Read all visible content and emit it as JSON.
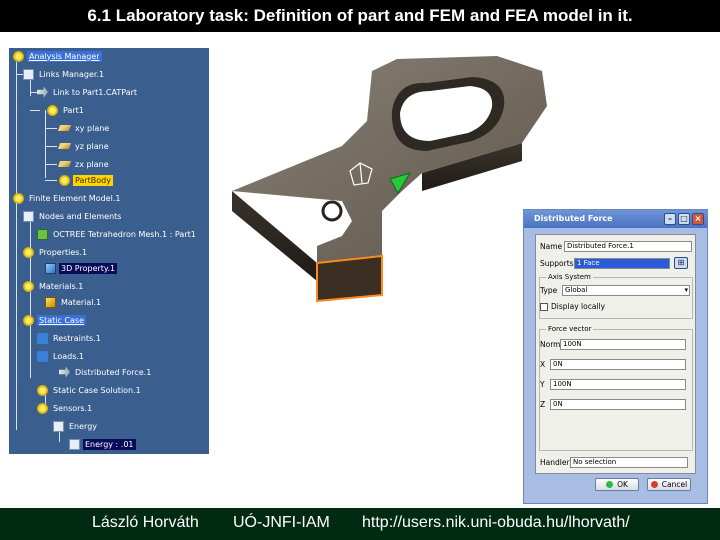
{
  "slide": {
    "title": "6.1 Laboratory task: Definition of part and FEM and FEA model in it."
  },
  "footer": {
    "author": "László Horváth",
    "institute": "UÓ-JNFI-IAM",
    "url": "http://users.nik.uni-obuda.hu/lhorvath/"
  },
  "tree": {
    "items": [
      {
        "label": "Analysis Manager",
        "icon": "analysis-icon"
      },
      {
        "label": "Links Manager.1",
        "icon": "links-icon"
      },
      {
        "label": "Link to Part1.CATPart",
        "icon": "link-icon"
      },
      {
        "label": "Part1",
        "icon": "part-icon"
      },
      {
        "label": "xy plane",
        "icon": "plane-icon"
      },
      {
        "label": "yz plane",
        "icon": "plane-icon"
      },
      {
        "label": "zx plane",
        "icon": "plane-icon"
      },
      {
        "label": "PartBody",
        "icon": "body-icon"
      },
      {
        "label": "Finite Element Model.1",
        "icon": "fem-icon"
      },
      {
        "label": "Nodes and Elements",
        "icon": "nodes-icon"
      },
      {
        "label": "OCTREE Tetrahedron Mesh.1 : Part1",
        "icon": "mesh-icon"
      },
      {
        "label": "Properties.1",
        "icon": "properties-icon"
      },
      {
        "label": "3D Property.1",
        "icon": "property-icon"
      },
      {
        "label": "Materials.1",
        "icon": "materials-icon"
      },
      {
        "label": "Material.1",
        "icon": "material-icon"
      },
      {
        "label": "Static Case",
        "icon": "case-icon"
      },
      {
        "label": "Restraints.1",
        "icon": "restraints-icon"
      },
      {
        "label": "Loads.1",
        "icon": "loads-icon"
      },
      {
        "label": "Distributed Force.1",
        "icon": "force-icon"
      },
      {
        "label": "Static Case Solution.1",
        "icon": "solution-icon"
      },
      {
        "label": "Sensors.1",
        "icon": "sensors-icon"
      },
      {
        "label": "Energy",
        "icon": "energy-icon"
      },
      {
        "label": "Energy : .01",
        "icon": "energy-value-icon"
      }
    ]
  },
  "dialog": {
    "title": "Distributed Force",
    "name_label": "Name",
    "name_value": "Distributed Force.1",
    "supports_label": "Supports",
    "supports_value": "1 Face",
    "axis_group": "Axis System",
    "type_label": "Type",
    "type_value": "Global",
    "display_locally": "Display locally",
    "force_group": "Force vector",
    "norm_label": "Norm",
    "norm_value": "100N",
    "x_label": "X",
    "x_value": "0N",
    "y_label": "Y",
    "y_value": "100N",
    "z_label": "Z",
    "z_value": "0N",
    "handler_label": "Handler",
    "handler_value": "No selection",
    "ok_label": "OK",
    "cancel_label": "Cancel"
  },
  "colors": {
    "tree_bg": "#3a5f8f",
    "part_surface": "#6b6256",
    "dialog_bg": "#a8bde3",
    "footer_bg": "#002b12"
  }
}
